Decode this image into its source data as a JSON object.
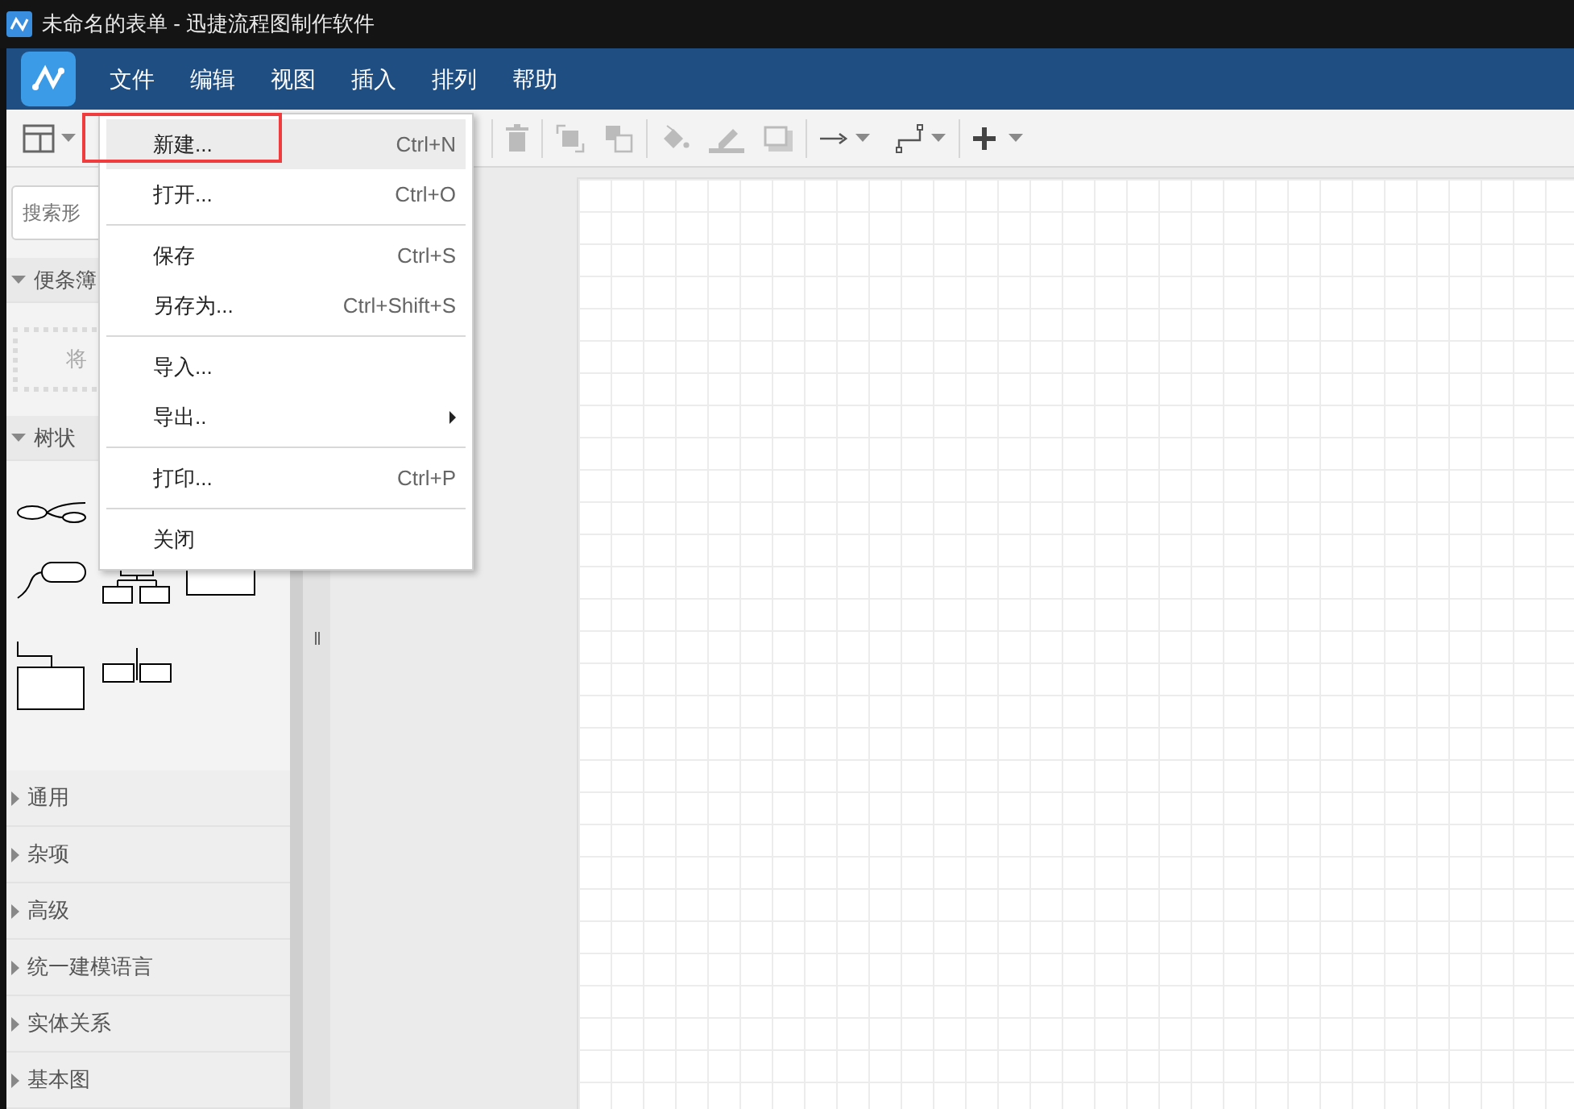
{
  "window": {
    "title": "未命名的表单 - 迅捷流程图制作软件"
  },
  "menubar": [
    "文件",
    "编辑",
    "视图",
    "插入",
    "排列",
    "帮助"
  ],
  "file_menu": [
    {
      "kind": "item",
      "label": "新建...",
      "shortcut": "Ctrl+N",
      "highlighted": true,
      "outlined": true,
      "submenu": false
    },
    {
      "kind": "item",
      "label": "打开...",
      "shortcut": "Ctrl+O",
      "highlighted": false,
      "outlined": false,
      "submenu": false
    },
    {
      "kind": "separator"
    },
    {
      "kind": "item",
      "label": "保存",
      "shortcut": "Ctrl+S",
      "highlighted": false,
      "outlined": false,
      "submenu": false
    },
    {
      "kind": "item",
      "label": "另存为...",
      "shortcut": "Ctrl+Shift+S",
      "highlighted": false,
      "outlined": false,
      "submenu": false
    },
    {
      "kind": "separator"
    },
    {
      "kind": "item",
      "label": "导入...",
      "highlighted": false,
      "outlined": false,
      "submenu": false
    },
    {
      "kind": "item",
      "label": "导出..",
      "highlighted": false,
      "outlined": false,
      "submenu": true
    },
    {
      "kind": "separator"
    },
    {
      "kind": "item",
      "label": "打印...",
      "shortcut": "Ctrl+P",
      "highlighted": false,
      "outlined": false,
      "submenu": false
    },
    {
      "kind": "separator"
    },
    {
      "kind": "item",
      "label": "关闭",
      "highlighted": false,
      "outlined": false,
      "submenu": false
    }
  ],
  "sidebar": {
    "search": {
      "placeholder": "搜索形"
    },
    "sections": [
      {
        "title": "便条簿",
        "expanded": true,
        "kind": "scratchpad",
        "hint": "将"
      },
      {
        "title": "树状",
        "expanded": true,
        "kind": "shapes"
      },
      {
        "title": "通用",
        "expanded": false
      },
      {
        "title": "杂项",
        "expanded": false
      },
      {
        "title": "高级",
        "expanded": false
      },
      {
        "title": "统一建模语言",
        "expanded": false
      },
      {
        "title": "实体关系",
        "expanded": false
      },
      {
        "title": "基本图",
        "expanded": false
      }
    ]
  }
}
